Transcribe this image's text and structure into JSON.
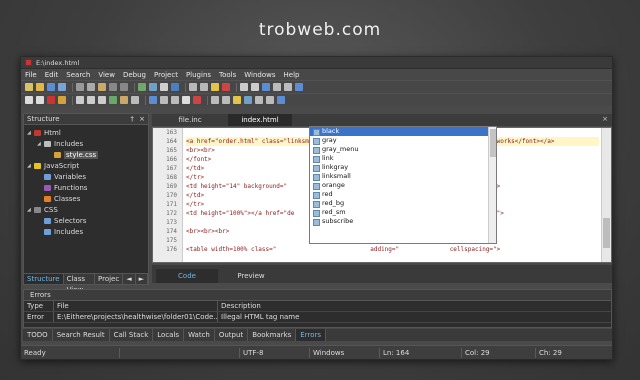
{
  "brand": "trobweb.com",
  "window": {
    "title": "E:\\index.html"
  },
  "menu": [
    "File",
    "Edit",
    "Search",
    "View",
    "Debug",
    "Project",
    "Plugins",
    "Tools",
    "Windows",
    "Help"
  ],
  "structure": {
    "title": "Structure",
    "pin": "†",
    "close": "×",
    "nodes": [
      {
        "label": "Html",
        "level": 0,
        "arrow": "◢",
        "icon": "#c0392b"
      },
      {
        "label": "Includes",
        "level": 1,
        "arrow": "◢",
        "icon": "#bdbdbd"
      },
      {
        "label": "style.css",
        "level": 2,
        "arrow": "",
        "icon": "#d4a13a",
        "selected": true
      },
      {
        "label": "JavaScript",
        "level": 0,
        "arrow": "◢",
        "icon": "#e6c229"
      },
      {
        "label": "Variables",
        "level": 1,
        "arrow": "",
        "icon": "#6f9fd8"
      },
      {
        "label": "Functions",
        "level": 1,
        "arrow": "",
        "icon": "#9b59b6"
      },
      {
        "label": "Classes",
        "level": 1,
        "arrow": "",
        "icon": "#e67e22"
      },
      {
        "label": "CSS",
        "level": 0,
        "arrow": "◢",
        "icon": "#888888"
      },
      {
        "label": "Selectors",
        "level": 1,
        "arrow": "",
        "icon": "#6f9fd8"
      },
      {
        "label": "Includes",
        "level": 1,
        "arrow": "",
        "icon": "#6f9fd8"
      }
    ],
    "tabs": [
      "Structure",
      "Class View",
      "Projec"
    ],
    "nav_left": "◄",
    "nav_right": "►"
  },
  "editor": {
    "tabs": [
      "file.inc",
      "index.html"
    ],
    "active_tab": 1,
    "close": "×",
    "lines": [
      {
        "n": "163",
        "text": ""
      },
      {
        "n": "164",
        "text": "<a href=\"order.html\" class=\"linksmall\"><font color=\"#FF0000\">Get Support for All Frameworks</font></a>",
        "hl": true
      },
      {
        "n": "165",
        "text": "<br><br>"
      },
      {
        "n": "166",
        "text": "</font>"
      },
      {
        "n": "167",
        "text": "</td>"
      },
      {
        "n": "168",
        "text": "</tr>"
      },
      {
        "n": "169",
        "text": "<td height=\"14\" background=\"                              \" width=\"1\" height=\"14\"></td>"
      },
      {
        "n": "170",
        "text": "</td>"
      },
      {
        "n": "171",
        "text": "</tr>"
      },
      {
        "n": "172",
        "text": "<td height=\"100%\"></a href=\"de                          se Info</a><font class=\"orange\">"
      },
      {
        "n": "173",
        "text": ""
      },
      {
        "n": "174",
        "text": "<br><br><br>"
      },
      {
        "n": "175",
        "text": ""
      },
      {
        "n": "176",
        "text": "<table width=100% class=\"                          adding=\"              cellspacing=\">"
      }
    ],
    "view_tabs": [
      "Code",
      "Preview"
    ],
    "active_view": 0
  },
  "autocomplete": {
    "items": [
      "black",
      "gray",
      "gray_menu",
      "link",
      "linkgray",
      "linksmall",
      "orange",
      "red",
      "red_bg",
      "red_sm",
      "subscribe"
    ],
    "selected": 0
  },
  "errors": {
    "title": "Errors",
    "columns": [
      "Type",
      "File",
      "Description"
    ],
    "rows": [
      {
        "type": "Error",
        "file": "E:\\Eithere\\projects\\healthwise\\folder01\\Code...",
        "desc": "Illegal HTML tag name"
      }
    ]
  },
  "bottom_tabs": [
    "TODO",
    "Search Result",
    "Call Stack",
    "Locals",
    "Watch",
    "Output",
    "Bookmarks",
    "Errors"
  ],
  "active_bottom_tab": 7,
  "status": {
    "ready": "Ready",
    "encoding": "UTF-8",
    "line_ending": "Windows",
    "line": "Ln: 164",
    "col": "Col: 29",
    "ch": "Ch: 29"
  },
  "colors": {
    "accent": "#6fb7e6",
    "selection": "#3b73c8",
    "tag_text": "#8b1a1a"
  }
}
